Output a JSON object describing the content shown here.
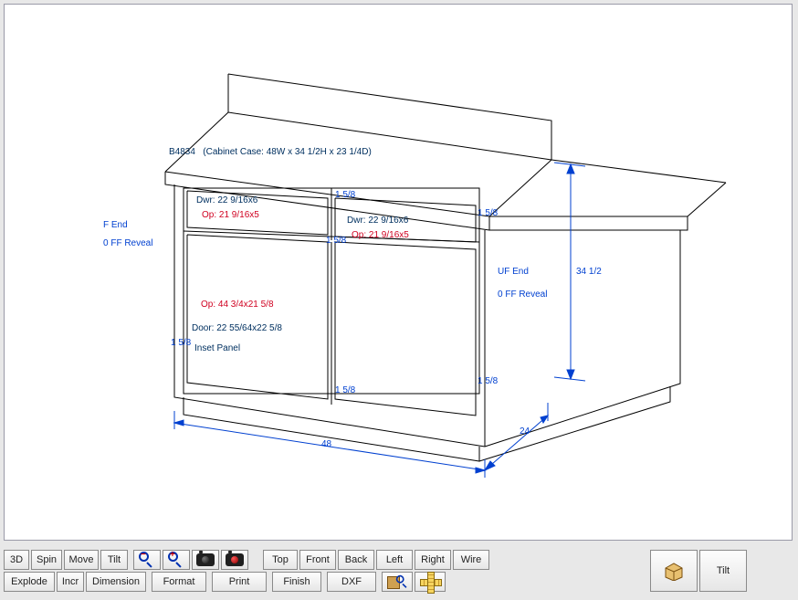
{
  "cabinet": {
    "id_label": "B4834",
    "case_label": "(Cabinet Case: 48W x 34 1/2H x 23 1/4D)",
    "left_annotations": {
      "end": "F End",
      "ff_reveal": "0 FF Reveal"
    },
    "right_annotations": {
      "end": "UF End",
      "ff_reveal": "0 FF Reveal"
    },
    "drawer_left": {
      "dwr": "Dwr: 22 9/16x6",
      "op": "Op: 21 9/16x5"
    },
    "drawer_right": {
      "dwr": "Dwr: 22 9/16x6",
      "op": "Op: 21 9/16x5"
    },
    "door": {
      "op": "Op: 44 3/4x21 5/8",
      "door": "Door: 22 55/64x22 5/8",
      "inset": "Inset Panel"
    },
    "dims": {
      "width": "48",
      "depth": "24",
      "height": "34 1/2",
      "reveal_top": "1 5/8",
      "reveal_right_top": "1 5/8",
      "reveal_left": "1 5/8",
      "reveal_bottom": "1 5/8",
      "reveal_right": "1 5/8",
      "reveal_mid": "1 5/8"
    }
  },
  "toolbar": {
    "row1": {
      "three_d": "3D",
      "spin": "Spin",
      "move": "Move",
      "tilt": "Tilt",
      "top": "Top",
      "front": "Front",
      "back": "Back",
      "left": "Left",
      "right": "Right",
      "wire": "Wire"
    },
    "row2": {
      "explode": "Explode",
      "incr": "Incr",
      "dimension": "Dimension",
      "format": "Format",
      "print": "Print",
      "finish": "Finish",
      "dxf": "DXF"
    },
    "right_big": {
      "tilt": "Tilt"
    }
  }
}
